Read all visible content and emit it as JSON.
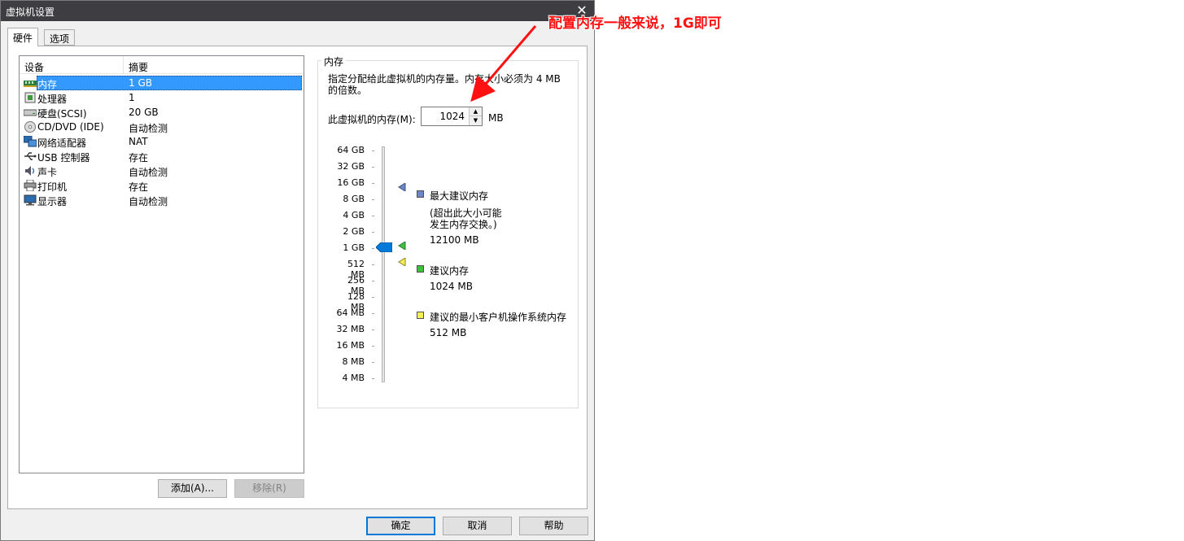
{
  "window": {
    "title": "虚拟机设置",
    "close_glyph": "✕"
  },
  "tabs": [
    {
      "label": "硬件"
    },
    {
      "label": "选项"
    }
  ],
  "device_list": {
    "header": {
      "device": "设备",
      "summary": "摘要"
    },
    "rows": [
      {
        "name": "内存",
        "summary": "1 GB",
        "icon": "memory-icon",
        "selected": true
      },
      {
        "name": "处理器",
        "summary": "1",
        "icon": "processor-icon"
      },
      {
        "name": "硬盘(SCSI)",
        "summary": "20 GB",
        "icon": "hard-disk-icon"
      },
      {
        "name": "CD/DVD (IDE)",
        "summary": "自动检测",
        "icon": "cd-dvd-icon"
      },
      {
        "name": "网络适配器",
        "summary": "NAT",
        "icon": "network-adapter-icon"
      },
      {
        "name": "USB 控制器",
        "summary": "存在",
        "icon": "usb-icon"
      },
      {
        "name": "声卡",
        "summary": "自动检测",
        "icon": "sound-card-icon"
      },
      {
        "name": "打印机",
        "summary": "存在",
        "icon": "printer-icon"
      },
      {
        "name": "显示器",
        "summary": "自动检测",
        "icon": "display-icon"
      }
    ]
  },
  "buttons": {
    "add": "添加(A)...",
    "remove": "移除(R)",
    "ok": "确定",
    "cancel": "取消",
    "help": "帮助"
  },
  "memory": {
    "group_title": "内存",
    "description_line1": "指定分配给此虚拟机的内存量。内存大小必须为 4 MB",
    "description_line2": "的倍数。",
    "field_label": "此虚拟机的内存(M):",
    "value": "1024",
    "unit": "MB",
    "scale": [
      "64 GB",
      "32 GB",
      "16 GB",
      "8 GB",
      "4 GB",
      "2 GB",
      "1 GB",
      "512 MB",
      "256 MB",
      "128 MB",
      "64 MB",
      "32 MB",
      "16 MB",
      "8 MB",
      "4 MB"
    ],
    "current_level": "1 GB",
    "legend": {
      "max": {
        "title": "最大建议内存",
        "note_line1": "(超出此大小可能",
        "note_line2": "发生内存交换。)",
        "value": "12100 MB",
        "color": "#6b87c8"
      },
      "recommended": {
        "title": "建议内存",
        "value": "1024 MB",
        "color": "#3fbf3f"
      },
      "min": {
        "title": "建议的最小客户机操作系统内存",
        "value": "512 MB",
        "color": "#f3ee5a"
      }
    }
  },
  "annotation": {
    "text": "配置内存一般来说，1G即可",
    "color": "#ff1111"
  }
}
